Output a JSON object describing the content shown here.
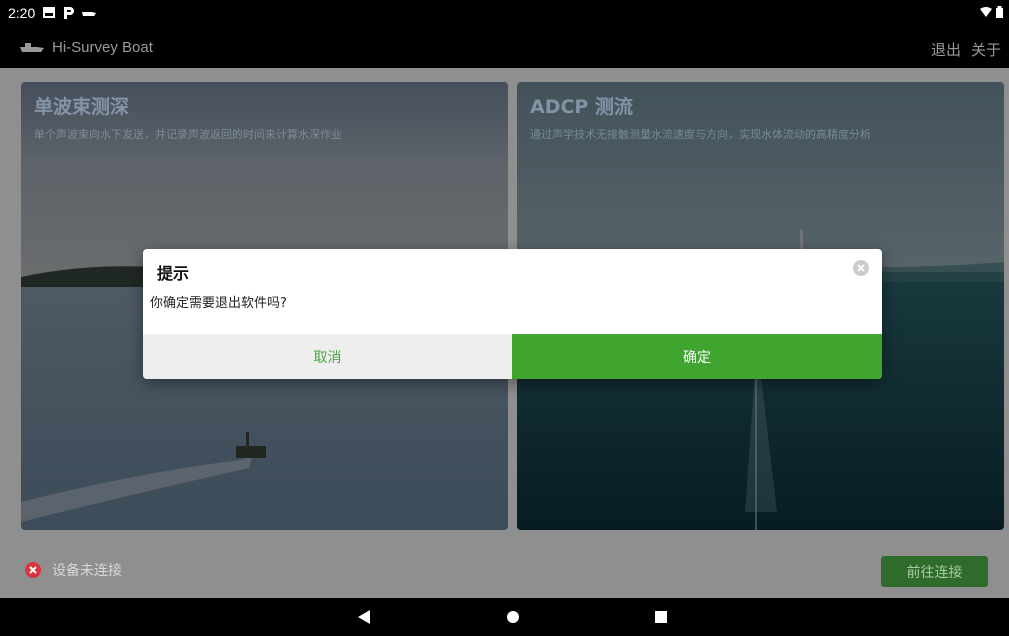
{
  "status_bar": {
    "time": "2:20"
  },
  "app_bar": {
    "title": "Hi-Survey Boat",
    "exit_label": "退出",
    "about_label": "关于"
  },
  "cards": [
    {
      "title": "单波束测深",
      "description": "单个声波束向水下发送，并记录声波返回的时间来计算水深作业"
    },
    {
      "title": "ADCP 测流",
      "description": "通过声学技术无接触测量水流速度与方向，实现水体流动的高精度分析"
    }
  ],
  "connection": {
    "status": "设备未连接",
    "button_label": "前往连接"
  },
  "dialog": {
    "title": "提示",
    "message": "你确定需要退出软件吗?",
    "cancel_label": "取消",
    "confirm_label": "确定"
  },
  "colors": {
    "accent": "#3fa52e",
    "error": "#d9343f"
  }
}
